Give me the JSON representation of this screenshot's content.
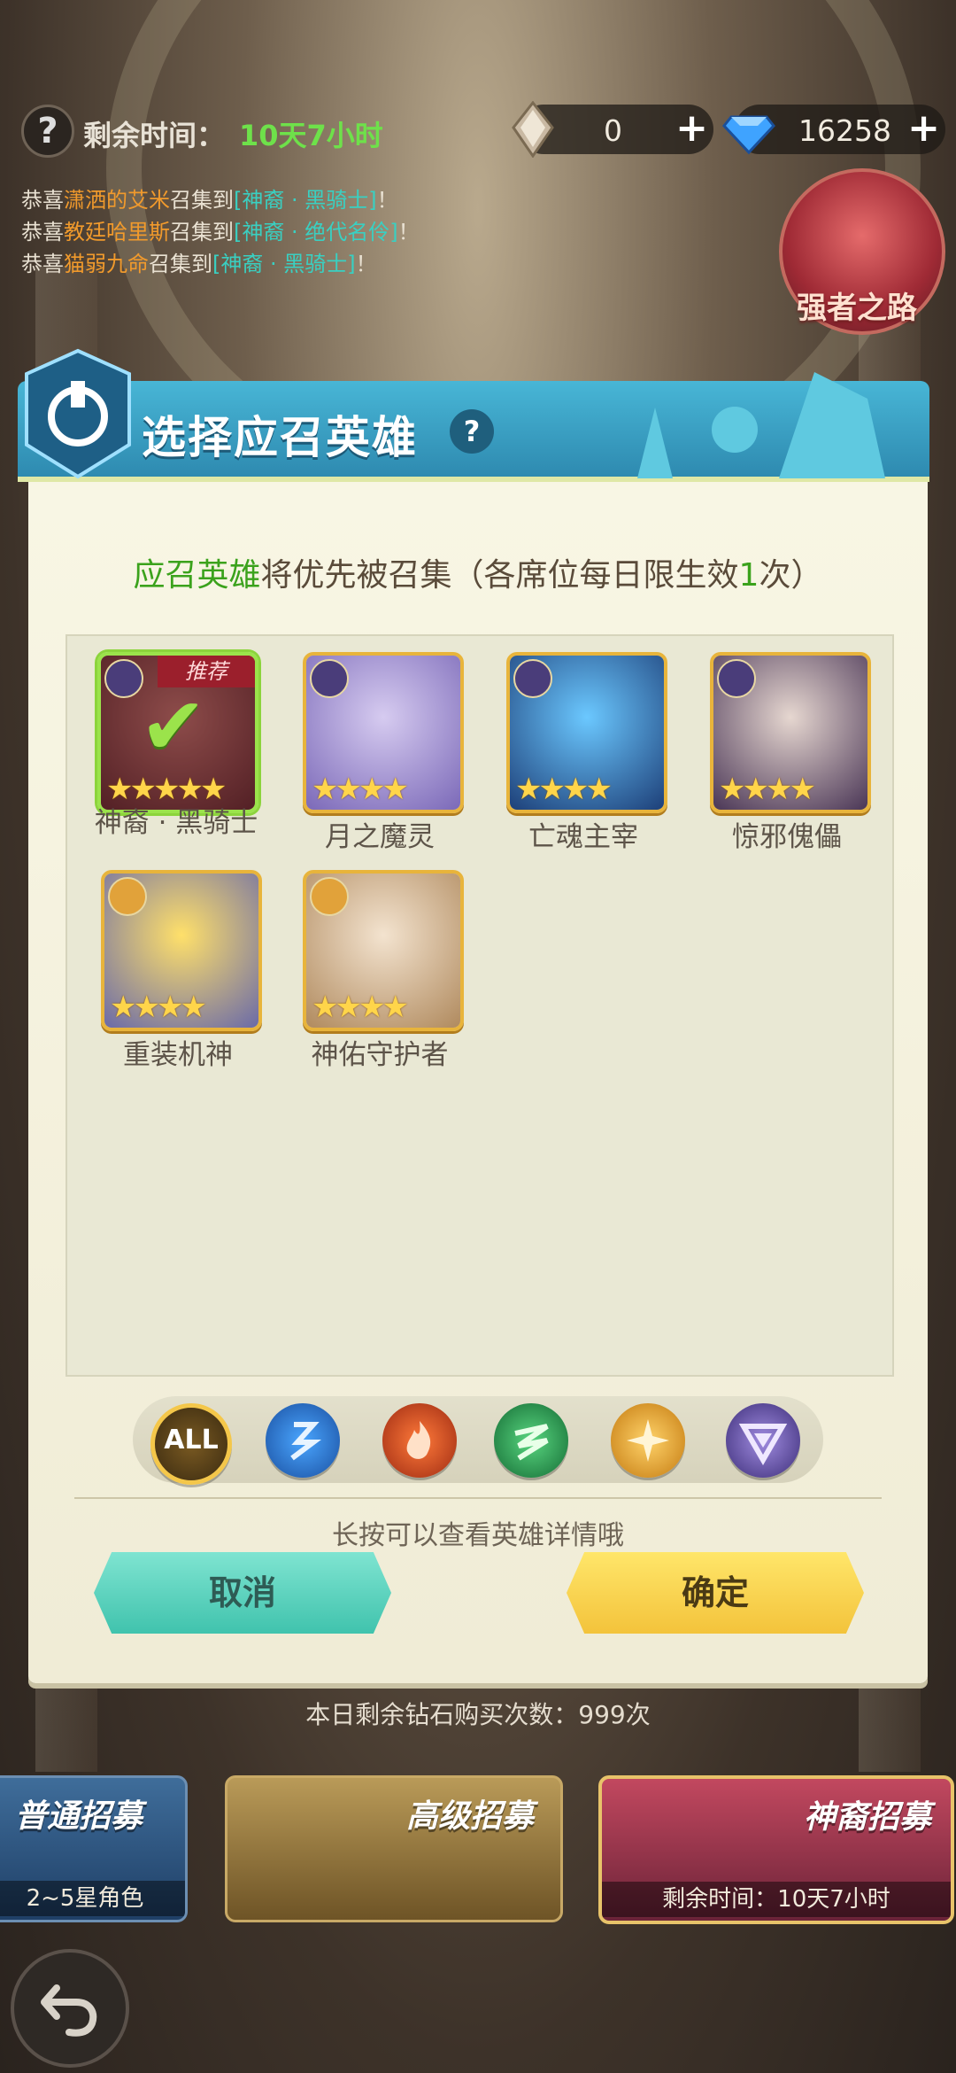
{
  "top": {
    "help": "?",
    "time_label": "剩余时间：",
    "time_value": "10天7小时",
    "currency1": {
      "icon": "crystal-icon",
      "value": "0"
    },
    "currency2": {
      "icon": "diamond-icon",
      "value": "16258"
    }
  },
  "messages": [
    {
      "prefix": "恭喜",
      "name": "潇洒的艾米",
      "middle": "召集到",
      "item": "[神裔 · 黑骑士]",
      "suffix": "！"
    },
    {
      "prefix": "恭喜",
      "name": "教廷哈里斯",
      "middle": "召集到",
      "item": "[神裔 · 绝代名伶]",
      "suffix": "！"
    },
    {
      "prefix": "恭喜",
      "name": "猫弱九命",
      "middle": "召集到",
      "item": "[神裔 · 黑骑士]",
      "suffix": "！"
    }
  ],
  "strong_road": "强者之路",
  "dialog": {
    "title": "选择应召英雄",
    "help": "?",
    "desc_green": "应召英雄",
    "desc_text": "将优先被召集（各席位每日限生效",
    "desc_count": "1",
    "desc_end": "次）",
    "heroes": [
      {
        "name": "神裔 · 黑骑士",
        "stars": "★★★★★",
        "tag": "推荐",
        "selected": true,
        "check": "✔"
      },
      {
        "name": "月之魔灵",
        "stars": "★★★★"
      },
      {
        "name": "亡魂主宰",
        "stars": "★★★★"
      },
      {
        "name": "惊邪傀儡",
        "stars": "★★★★"
      },
      {
        "name": "重装机神",
        "stars": "★★★★"
      },
      {
        "name": "神佑守护者",
        "stars": "★★★★"
      }
    ],
    "filters": {
      "all": "ALL"
    },
    "hint": "长按可以查看英雄详情哦",
    "cancel": "取消",
    "confirm": "确定"
  },
  "buy_count": "本日剩余钻石购买次数：999次",
  "tabs": {
    "normal": {
      "title": "普通招募",
      "sub": "2~5星角色"
    },
    "advanced": {
      "title": "高级招募"
    },
    "divine": {
      "title": "神裔招募",
      "sub": "剩余时间：10天7小时"
    }
  }
}
